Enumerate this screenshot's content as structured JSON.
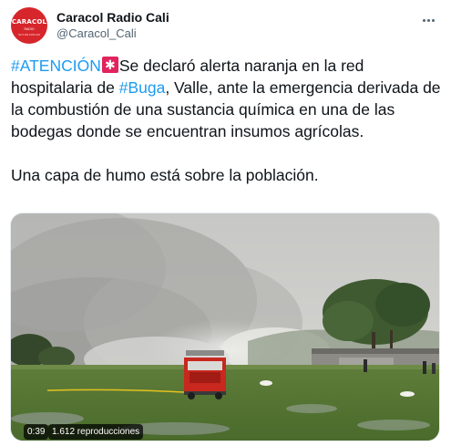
{
  "account": {
    "display_name": "Caracol Radio Cali",
    "handle": "@Caracol_Cali",
    "avatar_brand": "CARACOL",
    "avatar_sub": "RADIO",
    "avatar_sub2": "92.5 FM 1050 AM",
    "avatar_color": "#d6262b"
  },
  "tweet": {
    "tag_attention": "#ATENCIÓN",
    "siren_icon": "rotating-light-icon",
    "text_part1": "Se declaró alerta naranja en la red hospitalaria de ",
    "tag_city": "#Buga",
    "text_part2": ", Valle, ante la emergencia derivada de la combustión de una sustancia química en una de las bodegas donde se encuentran insumos agrícolas.",
    "text_part3": "Una capa de humo está sobre la población.",
    "link_color": "#1d9bf0"
  },
  "video": {
    "time": "0:39",
    "views": "1.612 reproducciones"
  }
}
